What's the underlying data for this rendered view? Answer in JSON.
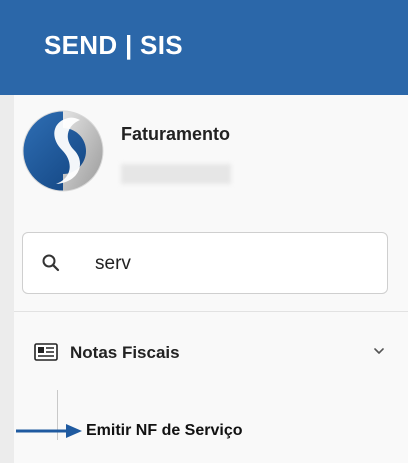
{
  "header": {
    "brand": "SEND | SIS"
  },
  "module": {
    "title": "Faturamento",
    "subtitle_redacted": true
  },
  "search": {
    "value": "serv"
  },
  "menu": {
    "group_label": "Notas Fiscais",
    "expanded": true,
    "items": [
      {
        "label": "Emitir NF de Serviço"
      }
    ]
  },
  "icons": {
    "search": "search-icon",
    "group": "newspaper-icon",
    "chevron": "chevron-down-icon",
    "pointer": "arrow-right-icon"
  },
  "colors": {
    "header_bg": "#2b67a9",
    "arrow": "#1f5aa0"
  }
}
